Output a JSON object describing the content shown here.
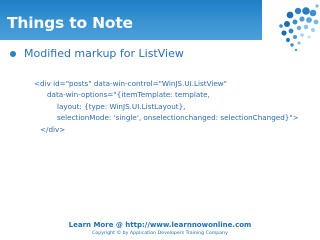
{
  "slide": {
    "title": "Things to Note",
    "bullet": "Modified markup for ListView",
    "code_lines": [
      "<div id=\"posts\" data-win-control=\"WinJS.UI.ListView\"",
      "data-win-options=\"{itemTemplate: template,",
      "layout: {type: WinJS.UI.ListLayout},",
      "selectionMode: 'single', onselectionchanged: selectionChanged}\">",
      "</div>"
    ]
  },
  "footer": {
    "link": "Learn More @ http://www.learnnowonline.com",
    "copyright": "Copyright © by Application Developers Training Company"
  },
  "colors": {
    "header": "#3a93d3",
    "accent": "#2c7fc0",
    "text": "#2d6fb5"
  },
  "icons": {
    "logo": "dotted-swirl-logo-icon",
    "bullet": "bullet-dot-icon"
  }
}
